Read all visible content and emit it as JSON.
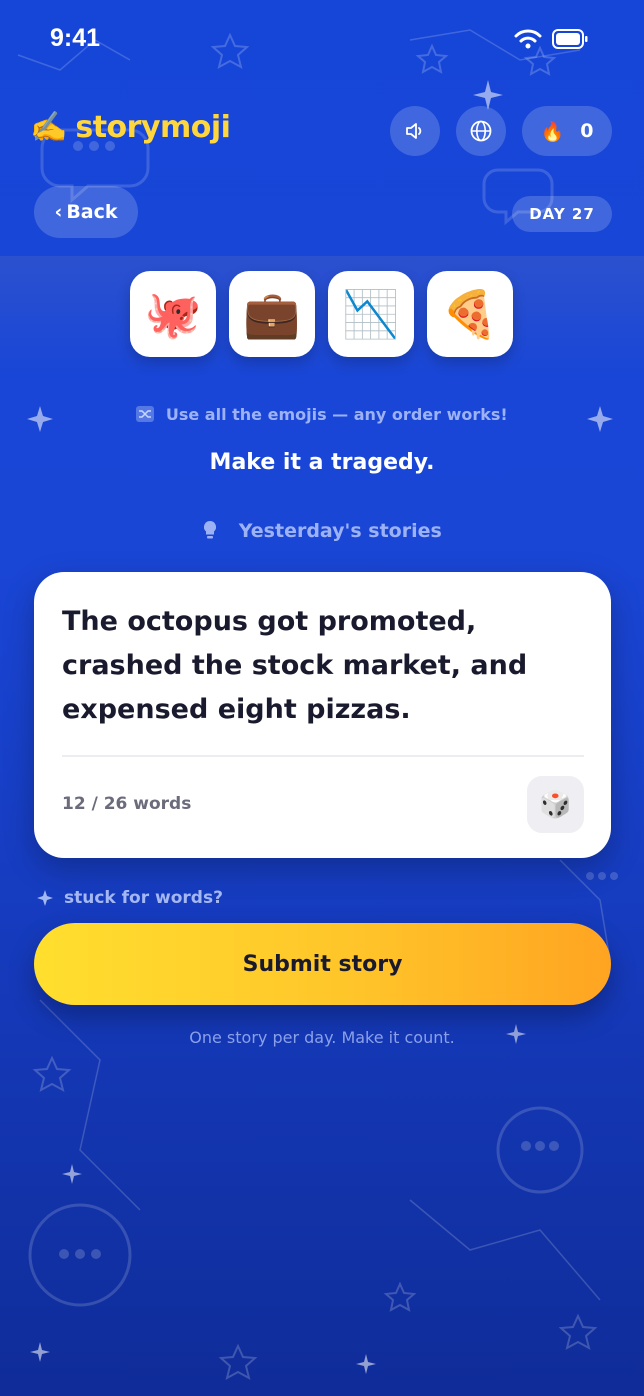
{
  "status_bar": {
    "time": "9:41"
  },
  "header": {
    "logo_emoji": "✍️",
    "logo_text": "storymoji",
    "sound_icon": "speaker-icon",
    "globe_icon": "globe-icon",
    "streak_emoji": "🔥",
    "streak_count": "0"
  },
  "nav": {
    "back_label": "Back",
    "day_label": "DAY 27"
  },
  "emojis": [
    "🐙",
    "💼",
    "📉",
    "🍕"
  ],
  "hint": "Use all the emojis — any order works!",
  "prompt": "Make it a tragedy.",
  "yesterday_label": "Yesterday's stories",
  "story": {
    "text": "The octopus got promoted, crashed the stock market, and expensed eight pizzas.",
    "word_count": "12 / 26 words",
    "dice": "🎲"
  },
  "stuck_label": "stuck for words?",
  "submit_label": "Submit story",
  "footnote": "One story per day. Make it count.",
  "colors": {
    "background": "#1a46d6",
    "logo": "#ffd63c",
    "submit_start": "#ffdf2e",
    "submit_end": "#ffa421"
  }
}
